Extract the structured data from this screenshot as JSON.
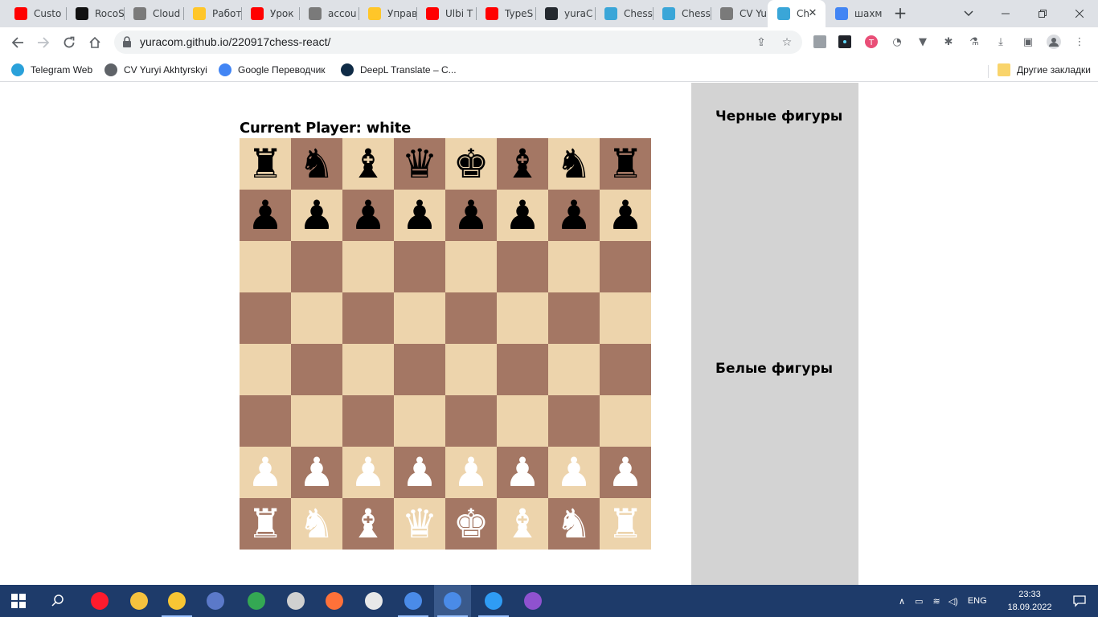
{
  "browser": {
    "tabs": [
      {
        "title": "Custo",
        "icon": "youtube-icon",
        "color": "#ff0000"
      },
      {
        "title": "RocoS",
        "icon": "rocoscript-icon",
        "color": "#111111"
      },
      {
        "title": "Cloud",
        "icon": "globe-icon",
        "color": "#7a7a7a"
      },
      {
        "title": "Работ",
        "icon": "firebase-icon",
        "color": "#ffc629"
      },
      {
        "title": "Урок",
        "icon": "youtube-icon",
        "color": "#ff0000"
      },
      {
        "title": "accou",
        "icon": "globe-icon",
        "color": "#7a7a7a"
      },
      {
        "title": "Управ",
        "icon": "firebase-icon",
        "color": "#ffc629"
      },
      {
        "title": "Ulbi T",
        "icon": "youtube-icon",
        "color": "#ff0000"
      },
      {
        "title": "TypeS",
        "icon": "youtube-icon",
        "color": "#ff0000"
      },
      {
        "title": "yuraC",
        "icon": "github-icon",
        "color": "#24292f"
      },
      {
        "title": "Chess",
        "icon": "chess-app-icon",
        "color": "#3aa6d8"
      },
      {
        "title": "Chess",
        "icon": "chess-app-icon",
        "color": "#3aa6d8"
      },
      {
        "title": "CV Yu",
        "icon": "globe-icon",
        "color": "#7a7a7a"
      },
      {
        "title": "Ch",
        "icon": "chess-app-icon",
        "color": "#3aa6d8",
        "active": true
      },
      {
        "title": "шахм",
        "icon": "google-icon",
        "color": "#4285f4"
      }
    ],
    "new_tab_symbol": "+",
    "url": "yuracom.github.io/220917chess-react/",
    "bookmarks": [
      {
        "label": "Telegram Web",
        "icon": "telegram-icon",
        "color": "#2aa1da"
      },
      {
        "label": "CV Yuryi Akhtyrskyi",
        "icon": "globe-icon",
        "color": "#5f6368"
      },
      {
        "label": "Google Переводчик",
        "icon": "google-translate-icon",
        "color": "#4285f4"
      },
      {
        "label": "DeepL Translate – С...",
        "icon": "deepl-icon",
        "color": "#0f2b46"
      }
    ],
    "other_bookmarks": "Другие закладки"
  },
  "page": {
    "current_player_label": "Current Player: white",
    "black_lost_title": "Черные фигуры",
    "white_lost_title": "Белые фигуры",
    "colors": {
      "light": "#edd4ac",
      "dark": "#a47764",
      "panel": "#d3d3d3"
    },
    "board": [
      [
        {
          "glyph": "♜",
          "piece": "rook",
          "color": "black"
        },
        {
          "glyph": "♞",
          "piece": "knight",
          "color": "black"
        },
        {
          "glyph": "♝",
          "piece": "bishop",
          "color": "black"
        },
        {
          "glyph": "♛",
          "piece": "queen",
          "color": "black"
        },
        {
          "glyph": "♚",
          "piece": "king",
          "color": "black"
        },
        {
          "glyph": "♝",
          "piece": "bishop",
          "color": "black"
        },
        {
          "glyph": "♞",
          "piece": "knight",
          "color": "black"
        },
        {
          "glyph": "♜",
          "piece": "rook",
          "color": "black"
        }
      ],
      [
        {
          "glyph": "♟",
          "piece": "pawn",
          "color": "black"
        },
        {
          "glyph": "♟",
          "piece": "pawn",
          "color": "black"
        },
        {
          "glyph": "♟",
          "piece": "pawn",
          "color": "black"
        },
        {
          "glyph": "♟",
          "piece": "pawn",
          "color": "black"
        },
        {
          "glyph": "♟",
          "piece": "pawn",
          "color": "black"
        },
        {
          "glyph": "♟",
          "piece": "pawn",
          "color": "black"
        },
        {
          "glyph": "♟",
          "piece": "pawn",
          "color": "black"
        },
        {
          "glyph": "♟",
          "piece": "pawn",
          "color": "black"
        }
      ],
      [
        null,
        null,
        null,
        null,
        null,
        null,
        null,
        null
      ],
      [
        null,
        null,
        null,
        null,
        null,
        null,
        null,
        null
      ],
      [
        null,
        null,
        null,
        null,
        null,
        null,
        null,
        null
      ],
      [
        null,
        null,
        null,
        null,
        null,
        null,
        null,
        null
      ],
      [
        {
          "glyph": "♟",
          "piece": "pawn",
          "color": "white"
        },
        {
          "glyph": "♟",
          "piece": "pawn",
          "color": "white"
        },
        {
          "glyph": "♟",
          "piece": "pawn",
          "color": "white"
        },
        {
          "glyph": "♟",
          "piece": "pawn",
          "color": "white"
        },
        {
          "glyph": "♟",
          "piece": "pawn",
          "color": "white"
        },
        {
          "glyph": "♟",
          "piece": "pawn",
          "color": "white"
        },
        {
          "glyph": "♟",
          "piece": "pawn",
          "color": "white"
        },
        {
          "glyph": "♟",
          "piece": "pawn",
          "color": "white"
        }
      ],
      [
        {
          "glyph": "♜",
          "piece": "rook",
          "color": "white"
        },
        {
          "glyph": "♞",
          "piece": "knight",
          "color": "white"
        },
        {
          "glyph": "♝",
          "piece": "bishop",
          "color": "white"
        },
        {
          "glyph": "♛",
          "piece": "queen",
          "color": "white"
        },
        {
          "glyph": "♚",
          "piece": "king",
          "color": "white"
        },
        {
          "glyph": "♝",
          "piece": "bishop",
          "color": "white"
        },
        {
          "glyph": "♞",
          "piece": "knight",
          "color": "white"
        },
        {
          "glyph": "♜",
          "piece": "rook",
          "color": "white"
        }
      ]
    ]
  },
  "taskbar": {
    "apps": [
      {
        "name": "opera",
        "color": "#ff1b2d",
        "running": false
      },
      {
        "name": "kali-tool",
        "color": "#f6c23e",
        "running": false
      },
      {
        "name": "file-explorer",
        "color": "#f8c634",
        "running": true
      },
      {
        "name": "floppy-app",
        "color": "#5b79c9",
        "running": false
      },
      {
        "name": "chrome",
        "color": "#34a853",
        "running": false
      },
      {
        "name": "calculator",
        "color": "#d0d0d0",
        "running": false
      },
      {
        "name": "firefox",
        "color": "#ff7139",
        "running": false
      },
      {
        "name": "magnifier-app",
        "color": "#e8e8e8",
        "running": false
      },
      {
        "name": "chromium",
        "color": "#4a8be8",
        "running": true
      },
      {
        "name": "chrome-running",
        "color": "#4a8be8",
        "running": true,
        "active": true
      },
      {
        "name": "vscode",
        "color": "#2f9cf4",
        "running": true
      },
      {
        "name": "github-desktop",
        "color": "#8f52cf",
        "running": false
      }
    ],
    "language": "ENG",
    "time": "23:33",
    "date": "18.09.2022"
  }
}
